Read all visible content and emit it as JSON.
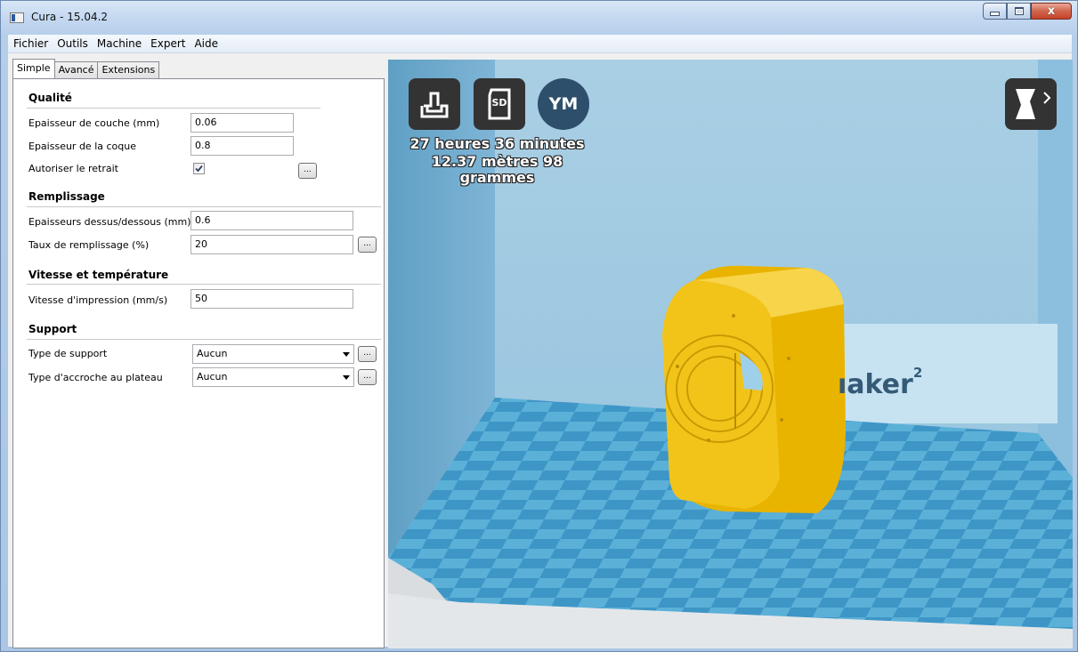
{
  "window": {
    "title": "Cura - 15.04.2",
    "close_glyph": "x"
  },
  "menu": {
    "items": [
      "Fichier",
      "Outils",
      "Machine",
      "Expert",
      "Aide"
    ]
  },
  "tabs": [
    "Simple",
    "Avancé",
    "Extensions"
  ],
  "sections": {
    "quality": {
      "title": "Qualité",
      "layer_height_label": "Epaisseur de couche (mm)",
      "layer_height_value": "0.06",
      "shell_thickness_label": "Epaisseur de la coque",
      "shell_thickness_value": "0.8",
      "retraction_label": "Autoriser le retrait",
      "retraction_checked": true
    },
    "fill": {
      "title": "Remplissage",
      "top_bottom_label": "Epaisseurs dessus/dessous (mm)",
      "top_bottom_value": "0.6",
      "density_label": "Taux de remplissage (%)",
      "density_value": "20"
    },
    "speed": {
      "title": "Vitesse et température",
      "print_speed_label": "Vitesse d'impression (mm/s)",
      "print_speed_value": "50"
    },
    "support": {
      "title": "Support",
      "support_type_label": "Type de support",
      "support_type_value": "Aucun",
      "adhesion_label": "Type d'accroche au plateau",
      "adhesion_value": "Aucun"
    }
  },
  "dots_label": "...",
  "viewport": {
    "print_time": "27 heures 36 minutes",
    "material": "12.37 mètres 98 grammes",
    "sd_label": "SD",
    "ym_label": "YM",
    "brand_text": "ıaker",
    "brand_sup": "2"
  },
  "colors": {
    "accent": "#f2c41a",
    "bed": "#4aa3cf",
    "platform_wall": "#8fc0de"
  }
}
